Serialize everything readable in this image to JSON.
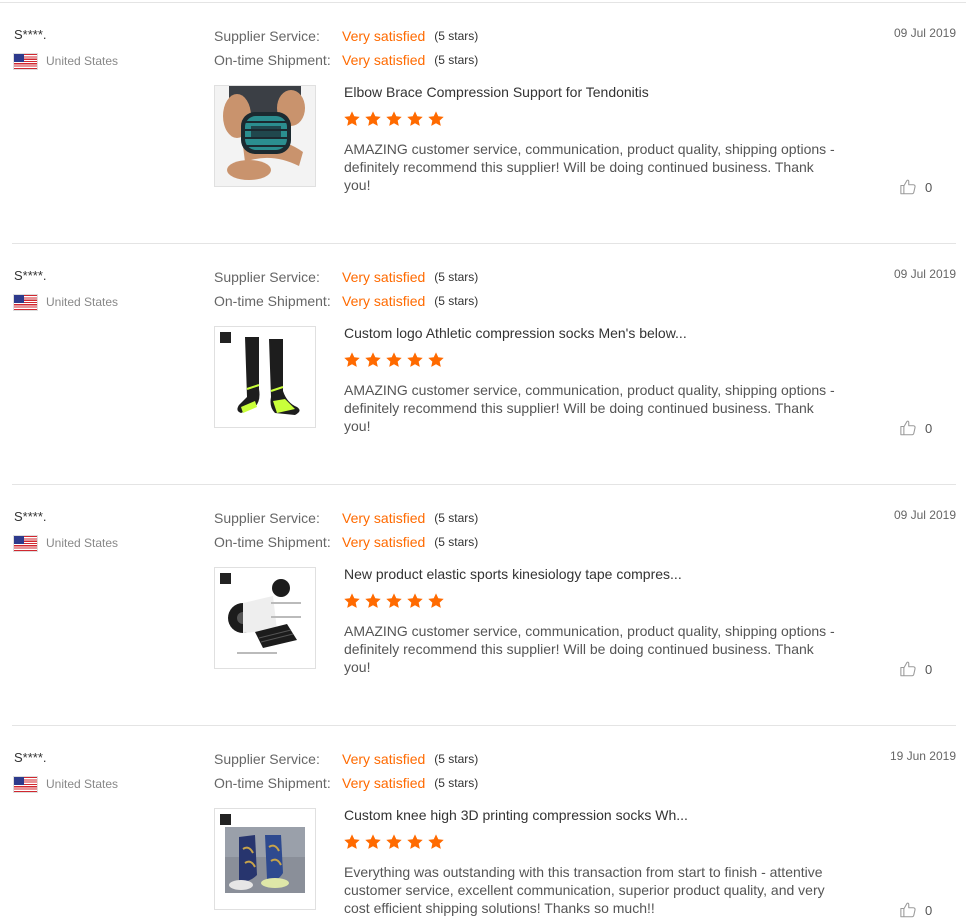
{
  "reviews": [
    {
      "buyer": "S****.",
      "country": "United States",
      "supplier_service_label": "Supplier Service:",
      "supplier_service_value": "Very satisfied",
      "supplier_service_stars": "(5 stars)",
      "shipment_label": "On-time Shipment:",
      "shipment_value": "Very satisfied",
      "shipment_stars": "(5 stars)",
      "date": "09 Jul 2019",
      "product_title": "Elbow Brace Compression Support for Tendonitis",
      "product_image": "elbow-brace-photo",
      "rating": 5,
      "comment": "AMAZING customer service, communication, product quality, shipping options - definitely recommend this supplier! Will be doing continued business. Thank you!",
      "helpful_count": "0"
    },
    {
      "buyer": "S****.",
      "country": "United States",
      "supplier_service_label": "Supplier Service:",
      "supplier_service_value": "Very satisfied",
      "supplier_service_stars": "(5 stars)",
      "shipment_label": "On-time Shipment:",
      "shipment_value": "Very satisfied",
      "shipment_stars": "(5 stars)",
      "date": "09 Jul 2019",
      "product_title": "Custom logo Athletic compression socks Men's below...",
      "product_image": "compression-socks-photo",
      "rating": 5,
      "comment": "AMAZING customer service, communication, product quality, shipping options - definitely recommend this supplier! Will be doing continued business. Thank you!",
      "helpful_count": "0"
    },
    {
      "buyer": "S****.",
      "country": "United States",
      "supplier_service_label": "Supplier Service:",
      "supplier_service_value": "Very satisfied",
      "supplier_service_stars": "(5 stars)",
      "shipment_label": "On-time Shipment:",
      "shipment_value": "Very satisfied",
      "shipment_stars": "(5 stars)",
      "date": "09 Jul 2019",
      "product_title": "New product elastic sports kinesiology tape compres...",
      "product_image": "kinesiology-tape-photo",
      "rating": 5,
      "comment": "AMAZING customer service, communication, product quality, shipping options - definitely recommend this supplier! Will be doing continued business. Thank you!",
      "helpful_count": "0"
    },
    {
      "buyer": "S****.",
      "country": "United States",
      "supplier_service_label": "Supplier Service:",
      "supplier_service_value": "Very satisfied",
      "supplier_service_stars": "(5 stars)",
      "shipment_label": "On-time Shipment:",
      "shipment_value": "Very satisfied",
      "shipment_stars": "(5 stars)",
      "date": "19 Jun 2019",
      "product_title": "Custom knee high 3D printing compression socks Wh...",
      "product_image": "3d-printed-socks-photo",
      "rating": 5,
      "comment": "Everything was outstanding with this transaction from start to finish - attentive customer service, excellent communication, superior product quality, and very cost efficient shipping solutions! Thanks so much!!",
      "helpful_count": "0"
    }
  ],
  "icons": {
    "flag": "us-flag-icon",
    "star": "star-icon",
    "helpful": "thumbs-up-icon"
  },
  "colors": {
    "accent": "#ff6a00",
    "star": "#ff6a00",
    "divider": "#e4e4e4",
    "muted_text": "#888888"
  }
}
